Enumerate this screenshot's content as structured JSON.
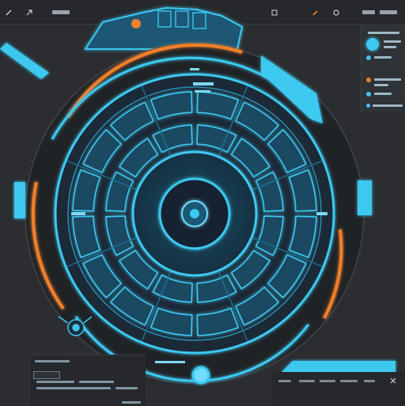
{
  "colors": {
    "background": "#2b2d30",
    "cyan": "#3cc8f0",
    "cyan_dim": "#1d6e8e",
    "orange": "#f0802a",
    "panel": "#26282b"
  },
  "topbar": {
    "icons": [
      "pencil-icon",
      "arrow-icon",
      "menu-icon",
      "tool-icon",
      "settings-icon",
      "grid-icon",
      "close-icon"
    ]
  },
  "hud": {
    "segments_outer": 16,
    "segments_inner": 12,
    "spokes": 8
  },
  "right_panel": {
    "rows": 5,
    "icons": [
      "avatar-icon",
      "status-dot-icon",
      "alert-dot-icon",
      "info-dot-icon"
    ]
  }
}
